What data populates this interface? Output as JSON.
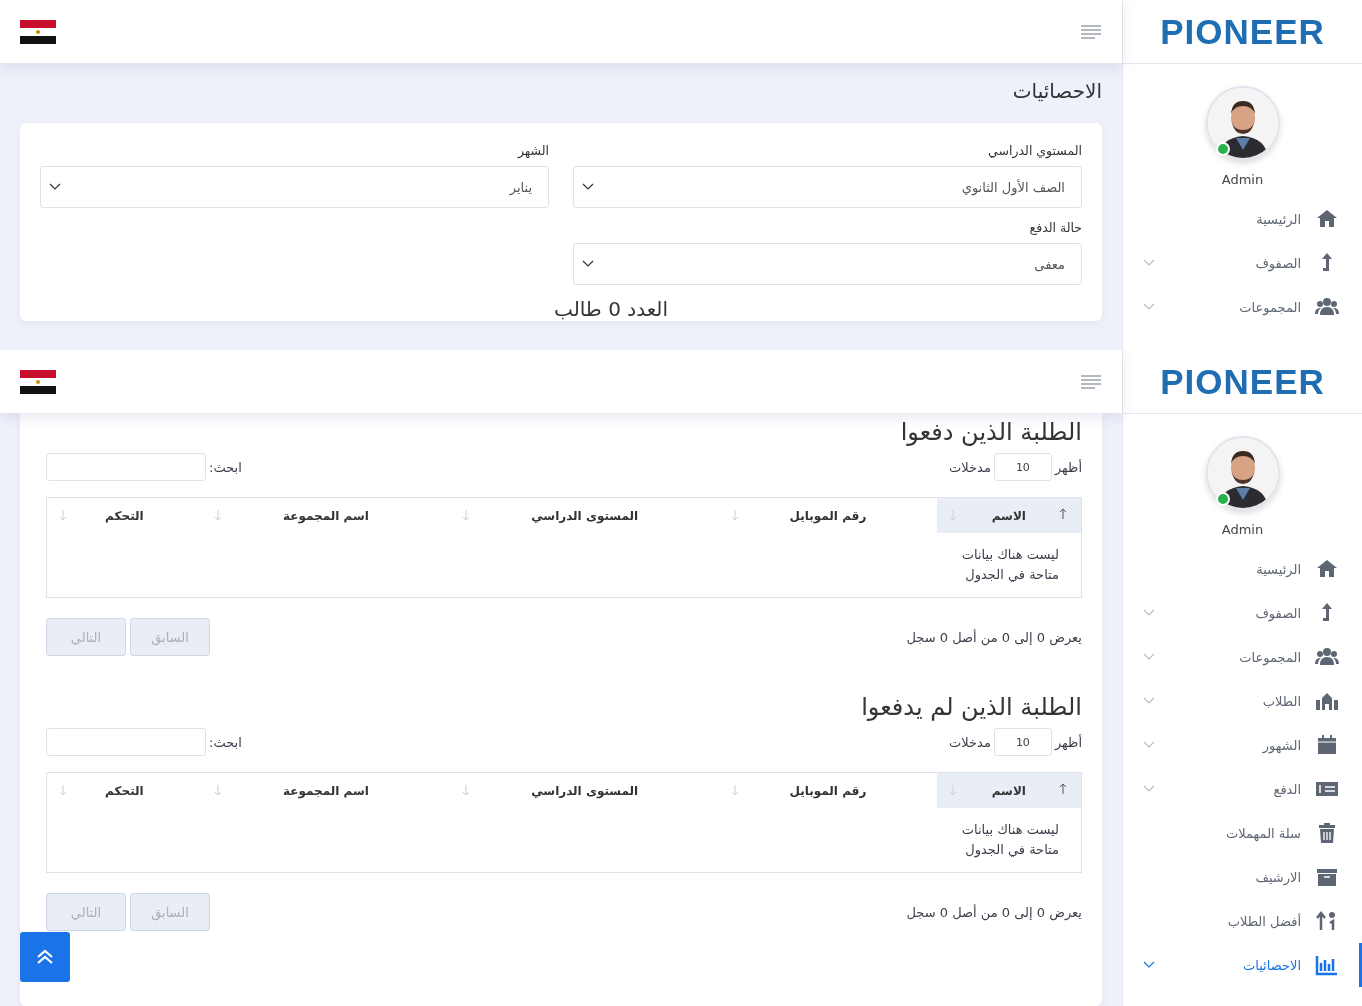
{
  "screen_top": {
    "logo": "PIONEER",
    "user": "Admin",
    "nav": [
      {
        "label": "الرئيسية",
        "has_submenu": false,
        "selected": false
      },
      {
        "label": "الصفوف",
        "has_submenu": true,
        "selected": false
      },
      {
        "label": "المجموعات",
        "has_submenu": true,
        "selected": false
      }
    ],
    "page_title": "الاحصائيات",
    "filters": [
      {
        "label": "المستوي الدراسي",
        "value": "الصف الأول الثانوي"
      },
      {
        "label": "الشهر",
        "value": "يناير"
      },
      {
        "label": "حالة الدفع",
        "value": "معفى"
      }
    ],
    "count_heading": "العدد 0 طالب"
  },
  "screen_bottom": {
    "logo": "PIONEER",
    "user": "Admin",
    "nav": [
      {
        "label": "الرئيسية",
        "has_submenu": false,
        "selected": false
      },
      {
        "label": "الصفوف",
        "has_submenu": true,
        "selected": false
      },
      {
        "label": "المجموعات",
        "has_submenu": true,
        "selected": false
      },
      {
        "label": "الطلاب",
        "has_submenu": true,
        "selected": false
      },
      {
        "label": "الشهور",
        "has_submenu": true,
        "selected": false
      },
      {
        "label": "الدفع",
        "has_submenu": true,
        "selected": false
      },
      {
        "label": "سلة المهملات",
        "has_submenu": false,
        "selected": false
      },
      {
        "label": "الارشيف",
        "has_submenu": false,
        "selected": false
      },
      {
        "label": "أفضل الطلاب",
        "has_submenu": false,
        "selected": false
      },
      {
        "label": "الاحصائيات",
        "has_submenu": true,
        "selected": true
      }
    ],
    "tables": [
      {
        "title": "الطلبة الذين دفعوا",
        "show_label": "أظهر",
        "page_size": "10",
        "entries_label": "مدخلات",
        "search_label": "ابحث:",
        "columns": [
          {
            "label": "الاسم",
            "sorted": true
          },
          {
            "label": "رقم الموبايل",
            "sorted": false
          },
          {
            "label": "المستوى الدراسي",
            "sorted": false
          },
          {
            "label": "اسم المجموعة",
            "sorted": false
          },
          {
            "label": "التحكم",
            "sorted": false
          }
        ],
        "empty_text": "ليست هناك بيانات متاحة في الجدول",
        "info": "يعرض 0 إلى 0 من أصل 0 سجل",
        "buttons": [
          {
            "label": "السابق",
            "disabled": true
          },
          {
            "label": "التالي",
            "disabled": true
          }
        ]
      },
      {
        "title": "الطلبة الذين لم يدفعوا",
        "show_label": "أظهر",
        "page_size": "10",
        "entries_label": "مدخلات",
        "search_label": "ابحث:",
        "columns": [
          {
            "label": "الاسم",
            "sorted": true
          },
          {
            "label": "رقم الموبايل",
            "sorted": false
          },
          {
            "label": "المستوى الدراسي",
            "sorted": false
          },
          {
            "label": "اسم المجموعة",
            "sorted": false
          },
          {
            "label": "التحكم",
            "sorted": false
          }
        ],
        "empty_text": "ليست هناك بيانات متاحة في الجدول",
        "info": "يعرض 0 إلى 0 من أصل 0 سجل",
        "buttons": [
          {
            "label": "السابق",
            "disabled": true
          },
          {
            "label": "التالي",
            "disabled": true
          }
        ]
      }
    ]
  }
}
